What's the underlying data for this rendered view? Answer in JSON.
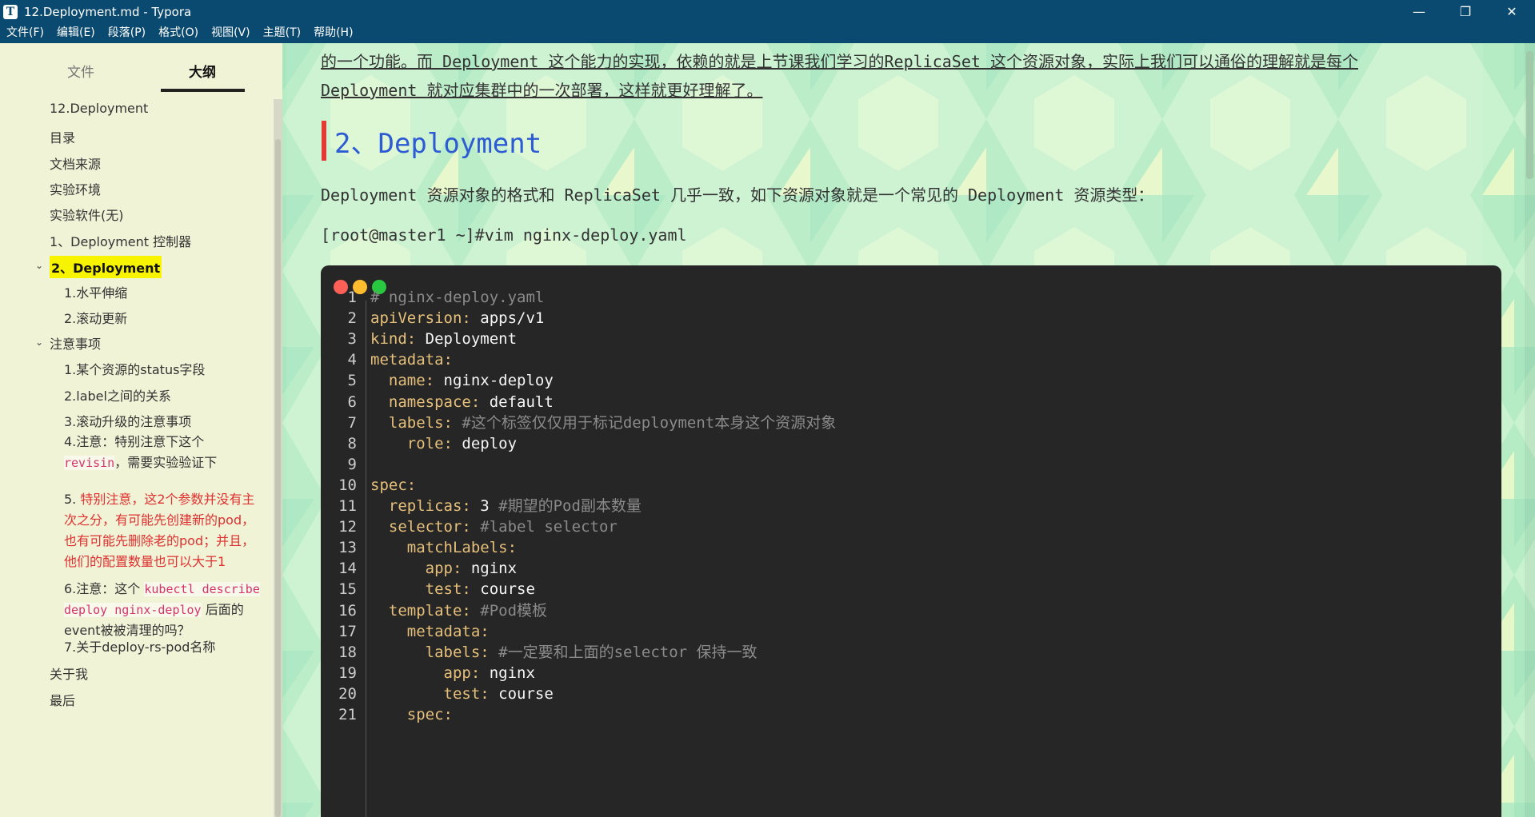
{
  "window": {
    "app_icon": "T",
    "title": "12.Deployment.md - Typora",
    "minimize": "—",
    "maximize": "❐",
    "close": "✕"
  },
  "menu": [
    "文件(F)",
    "编辑(E)",
    "段落(P)",
    "格式(O)",
    "视图(V)",
    "主题(T)",
    "帮助(H)"
  ],
  "sidebar": {
    "tabs": {
      "files": "文件",
      "outline": "大纲"
    },
    "outline": [
      "12.Deployment",
      "目录",
      "文档来源",
      "实验环境",
      "实验软件(无)",
      "1、Deployment 控制器",
      "2、Deployment",
      "1.水平伸缩",
      "2.滚动更新",
      "注意事项",
      "1.某个资源的status字段",
      "2.label之间的关系",
      "3.滚动升级的注意事项",
      "4.注意：特别注意下这个",
      "revisin",
      "，需要实验验证下",
      "5.",
      "特别注意，这2个参数并没有主次之分，有可能先创建新的pod，也有可能先删除老的pod；并且，他们的配置数量也可以大于1",
      "6.注意：这个",
      "kubectl describe deploy nginx-deploy",
      "后面的event被被清理的吗？",
      "7.关于deploy-rs-pod名称",
      "关于我",
      "最后"
    ]
  },
  "editor": {
    "intro_line1": "的一个功能。而 Deployment 这个能力的实现，依赖的就是上节课我们学习的ReplicaSet 这个资源对象，实际上我们可以通俗的理解就是每个",
    "intro_line2": "Deployment 就对应集群中的一次部署，这样就更好理解了。",
    "heading": "2、Deployment",
    "desc": "Deployment 资源对象的格式和 ReplicaSet 几乎一致，如下资源对象就是一个常见的 Deployment 资源类型：",
    "cmd": "[root@master1 ~]#vim nginx-deploy.yaml",
    "code": [
      {
        "n": "1",
        "k": "",
        "v": "",
        "c": "# nginx-deploy.yaml"
      },
      {
        "n": "2",
        "k": "apiVersion:",
        "v": " apps/v1",
        "c": ""
      },
      {
        "n": "3",
        "k": "kind:",
        "v": " Deployment",
        "c": ""
      },
      {
        "n": "4",
        "k": "metadata:",
        "v": "",
        "c": ""
      },
      {
        "n": "5",
        "k": "  name:",
        "v": " nginx-deploy",
        "c": ""
      },
      {
        "n": "6",
        "k": "  namespace:",
        "v": " default",
        "c": ""
      },
      {
        "n": "7",
        "k": "  labels:",
        "v": "",
        "c": " #这个标签仅仅用于标记deployment本身这个资源对象"
      },
      {
        "n": "8",
        "k": "    role:",
        "v": " deploy",
        "c": ""
      },
      {
        "n": "9",
        "k": "",
        "v": "",
        "c": ""
      },
      {
        "n": "10",
        "k": "spec:",
        "v": "",
        "c": ""
      },
      {
        "n": "11",
        "k": "  replicas:",
        "v": " 3",
        "c": " #期望的Pod副本数量"
      },
      {
        "n": "12",
        "k": "  selector:",
        "v": "",
        "c": " #label selector"
      },
      {
        "n": "13",
        "k": "    matchLabels:",
        "v": "",
        "c": ""
      },
      {
        "n": "14",
        "k": "      app:",
        "v": " nginx",
        "c": ""
      },
      {
        "n": "15",
        "k": "      test:",
        "v": " course",
        "c": ""
      },
      {
        "n": "16",
        "k": "  template:",
        "v": "",
        "c": " #Pod模板"
      },
      {
        "n": "17",
        "k": "    metadata:",
        "v": "",
        "c": ""
      },
      {
        "n": "18",
        "k": "      labels:",
        "v": "",
        "c": " #一定要和上面的selector 保持一致"
      },
      {
        "n": "19",
        "k": "        app:",
        "v": " nginx",
        "c": ""
      },
      {
        "n": "20",
        "k": "        test:",
        "v": " course",
        "c": ""
      },
      {
        "n": "21",
        "k": "    spec:",
        "v": "",
        "c": ""
      }
    ]
  },
  "colors": {
    "titlebar": "#0b4a70",
    "sidebar_bg": "#f1f3d6",
    "heading": "#2d5bd3",
    "heading_bar": "#e53935",
    "code_bg": "#262626",
    "active_highlight": "#f8f400"
  }
}
